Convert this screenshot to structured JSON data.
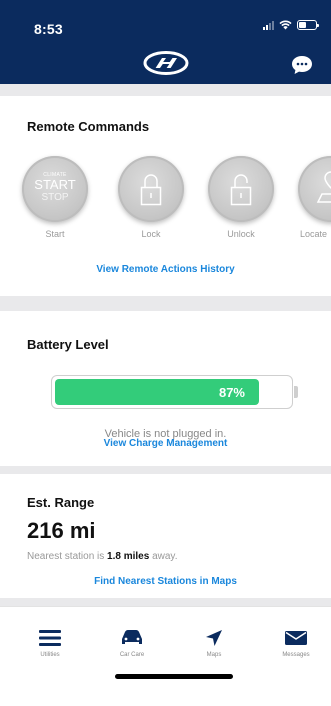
{
  "status_bar": {
    "time": "8:53"
  },
  "header": {
    "logo": "hyundai-logo",
    "chat_icon": "chat-bubble-icon",
    "bg_color": "#0b2b5e"
  },
  "remote_commands": {
    "title": "Remote Commands",
    "start": {
      "top_text": "CLIMATE",
      "main_text": "START",
      "sub_text": "STOP",
      "label": "Start"
    },
    "lock": {
      "label": "Lock"
    },
    "unlock": {
      "label": "Unlock"
    },
    "locate": {
      "label": "Locate"
    },
    "history_link": "View Remote Actions History"
  },
  "battery": {
    "title": "Battery Level",
    "percent_text": "87%",
    "percent": 87,
    "fill_color": "#33cc7a",
    "plug_status": "Vehicle is not plugged in.",
    "charge_link": "View Charge Management"
  },
  "range": {
    "title": "Est. Range",
    "value": "216 mi",
    "nearest_prefix": "Nearest station is ",
    "nearest_distance": "1.8 miles",
    "nearest_suffix": " away.",
    "maps_link": "Find Nearest Stations in Maps"
  },
  "bottom_nav": {
    "items": [
      {
        "label": "Utilities",
        "icon": "hamburger-icon"
      },
      {
        "label": "Car Care",
        "icon": "car-icon"
      },
      {
        "label": "Maps",
        "icon": "navigation-arrow-icon"
      },
      {
        "label": "Messages",
        "icon": "envelope-icon"
      }
    ]
  },
  "link_color": "#1a87dc"
}
